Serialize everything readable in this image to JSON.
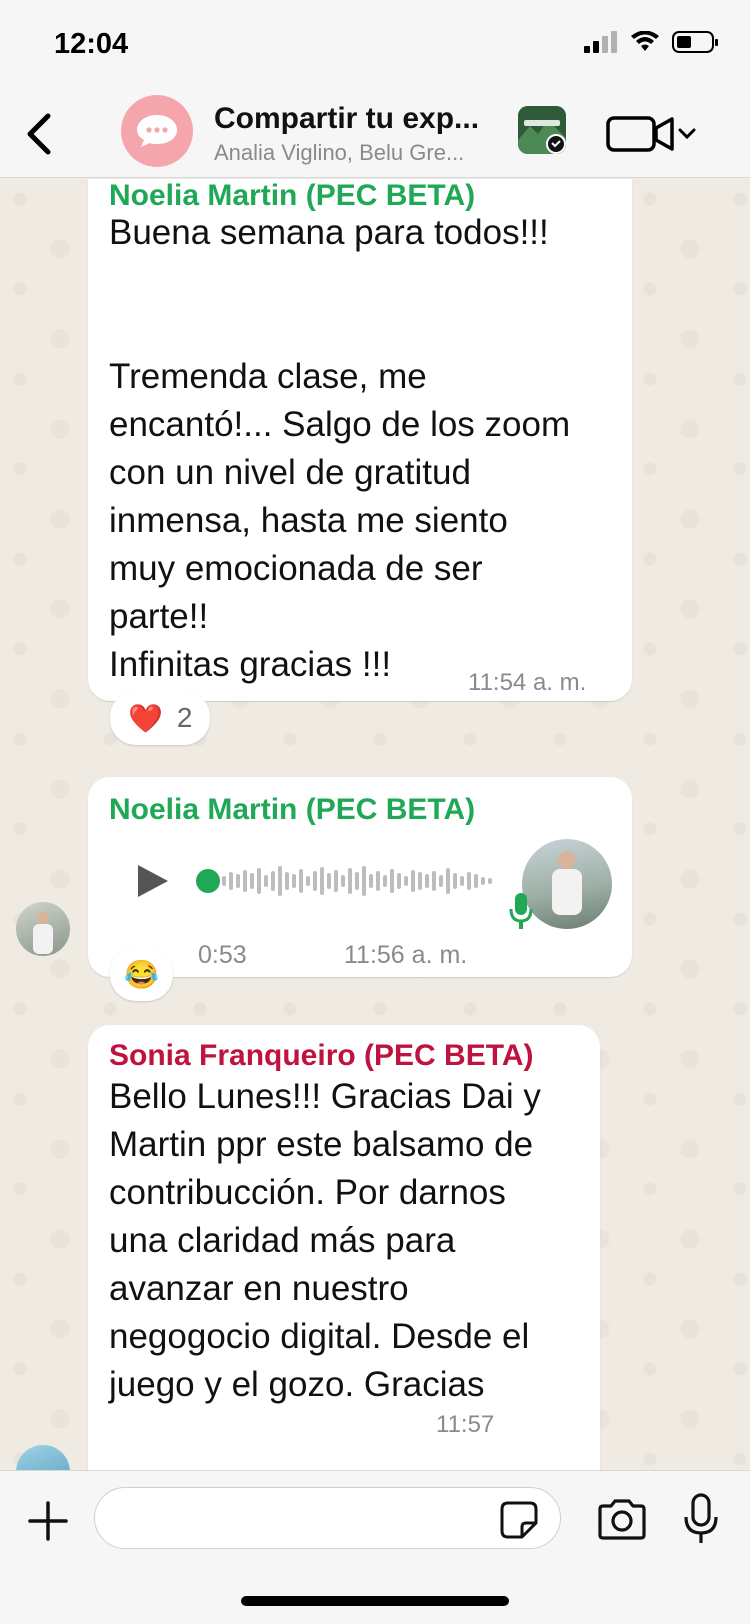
{
  "status_bar": {
    "time": "12:04"
  },
  "header": {
    "title": "Compartir tu exp...",
    "subtitle": "Analia Viglino, Belu Gre...",
    "icons": [
      "back-chevron-icon",
      "group-chat-icon",
      "video-camera-icon",
      "chevron-down-icon"
    ]
  },
  "messages": [
    {
      "sender": "Noelia Martin (PEC BETA)",
      "lines": [
        "Buena semana para todos!!!",
        "",
        "",
        "Tremenda clase, me",
        "encantó!... Salgo de los zoom",
        "con un nivel de gratitud",
        "inmensa, hasta me siento",
        "muy emocionada de ser",
        "parte!!",
        "Infinitas gracias !!!"
      ],
      "time": "11:54",
      "ampm": "a. m.",
      "reaction": {
        "emoji": "❤️",
        "count": "2"
      }
    },
    {
      "sender": "Noelia Martin (PEC BETA)",
      "type": "voice",
      "duration": "0:53",
      "time": "11:56",
      "ampm": "a. m.",
      "reaction": {
        "emoji": "😂"
      }
    },
    {
      "sender": "Sonia Franqueiro (PEC BETA)",
      "lines": [
        "Bello Lunes!!! Gracias Dai y",
        "Martin ppr este balsamo de",
        "contribucción. Por darnos",
        "una claridad más para",
        "avanzar en nuestro",
        "negogocio digital. Desde el",
        "juego y el gozo. Gracias"
      ],
      "time": "11:57"
    }
  ],
  "input": {
    "placeholder": ""
  },
  "colors": {
    "green_sender": "#1fa855",
    "red_sender": "#c0123f",
    "chat_bg": "#efeae2"
  }
}
